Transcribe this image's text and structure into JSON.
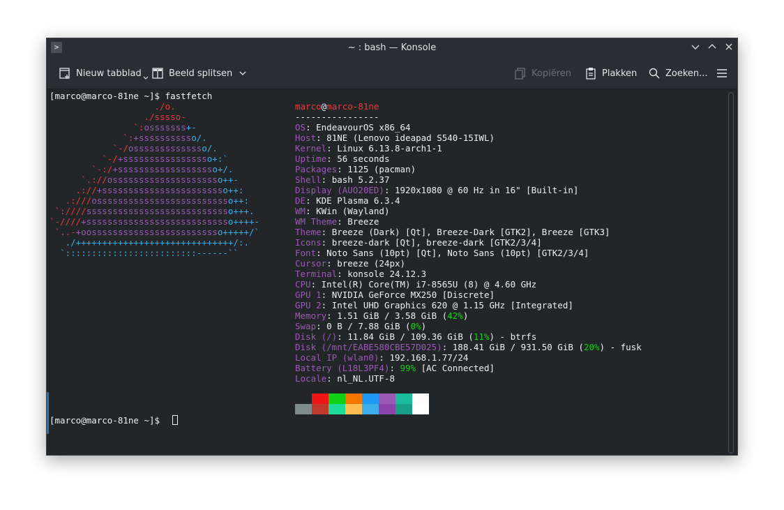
{
  "window": {
    "title": "~ : bash — Konsole"
  },
  "toolbar": {
    "new_tab": "Nieuw tabblad",
    "split_view": "Beeld splitsen",
    "copy": "Kopiëren",
    "paste": "Plakken",
    "find": "Zoeken..."
  },
  "terminal": {
    "prompt1": "[marco@marco-81ne ~]$ fastfetch",
    "prompt2": "[marco@marco-81ne ~]$ ",
    "user": "marco",
    "at": "@",
    "host": "marco-81ne",
    "separator": "----------------",
    "logo": [
      "                    ./o.",
      "                  ./sssso-",
      "                `:osssssss+-",
      "              `:+sssssssssso/.",
      "            `-/ossssssssssssso/.",
      "          `-/+sssssssssssssssso+:`",
      "        `-:/+sssssssssssssssssso+/.",
      "      `.://osssssssssssssssssssso++-",
      "     .://+ssssssssssssssssssssssso++:",
      "   .:///ossssssssssssssssssssssssso++:",
      " `:////ssssssssssssssssssssssssssso+++.",
      "`-////+ssssssssssssssssssssssssssso++++-",
      " `..-+oosssssssssssssssssssssssso+++++/`",
      "   ./++++++++++++++++++++++++++++++/:.",
      "  `:::::::::::::::::::::::::------``"
    ],
    "info": [
      {
        "label": "OS",
        "value": "EndeavourOS x86_64"
      },
      {
        "label": "Host",
        "value": "81NE (Lenovo ideapad S540-15IWL)"
      },
      {
        "label": "Kernel",
        "value": "Linux 6.13.8-arch1-1"
      },
      {
        "label": "Uptime",
        "value": "56 seconds"
      },
      {
        "label": "Packages",
        "value": "1125 (pacman)"
      },
      {
        "label": "Shell",
        "value": "bash 5.2.37"
      },
      {
        "label": "Display (AUO20ED)",
        "value": "1920x1080 @ 60 Hz in 16\" [Built-in]"
      },
      {
        "label": "DE",
        "value": "KDE Plasma 6.3.4"
      },
      {
        "label": "WM",
        "value": "KWin (Wayland)"
      },
      {
        "label": "WM Theme",
        "value": "Breeze"
      },
      {
        "label": "Theme",
        "value": "Breeze (Dark) [Qt], Breeze-Dark [GTK2], Breeze [GTK3]"
      },
      {
        "label": "Icons",
        "value": "breeze-dark [Qt], breeze-dark [GTK2/3/4]"
      },
      {
        "label": "Font",
        "value": "Noto Sans (10pt) [Qt], Noto Sans (10pt) [GTK2/3/4]"
      },
      {
        "label": "Cursor",
        "value": "breeze (24px)"
      },
      {
        "label": "Terminal",
        "value": "konsole 24.12.3"
      },
      {
        "label": "CPU",
        "value": "Intel(R) Core(TM) i7-8565U (8) @ 4.60 GHz"
      },
      {
        "label": "GPU 1",
        "value": "NVIDIA GeForce MX250 [Discrete]"
      },
      {
        "label": "GPU 2",
        "value": "Intel UHD Graphics 620 @ 1.15 GHz [Integrated]"
      },
      {
        "label": "Memory",
        "value": "1.51 GiB / 3.58 GiB (",
        "pct": "42%",
        "tail": ")"
      },
      {
        "label": "Swap",
        "value": "0 B / 7.88 GiB (",
        "pct": "0%",
        "tail": ")"
      },
      {
        "label": "Disk (/)",
        "value": "11.84 GiB / 109.36 GiB (",
        "pct": "11%",
        "tail": ") - btrfs"
      },
      {
        "label": "Disk (/mnt/EABE580CBE57D025)",
        "value": "188.41 GiB / 931.50 GiB (",
        "pct": "20%",
        "tail": ") - fusk"
      },
      {
        "label": "Local IP (wlan0)",
        "value": "192.168.1.77/24"
      },
      {
        "label": "Battery (L18L3PF4)",
        "value": "",
        "pct": "99%",
        "tail": " [AC Connected]"
      },
      {
        "label": "Locale",
        "value": "nl_NL.UTF-8"
      }
    ]
  },
  "colors": {
    "palette_top": [
      "#232629",
      "#ed1515",
      "#11d116",
      "#f67400",
      "#1d99f3",
      "#9b59b6",
      "#1abc9c",
      "#fcfcfc"
    ],
    "palette_bottom": [
      "#7f8c8d",
      "#c0392b",
      "#1cdc9a",
      "#fdbc4b",
      "#3daee9",
      "#8e44ad",
      "#16a085",
      "#ffffff"
    ]
  }
}
